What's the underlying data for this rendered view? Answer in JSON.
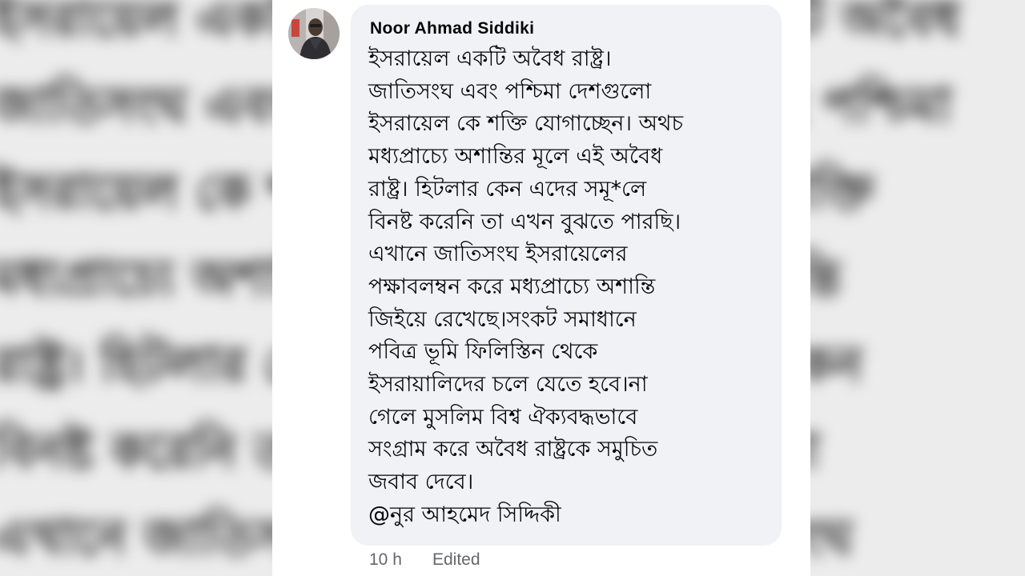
{
  "comment": {
    "author": "Noor Ahmad Siddiki",
    "lines": [
      "ইসরায়েল একটি অবৈধ রাষ্ট্র।",
      "জাতিসংঘ এবং পশ্চিমা দেশগুলো",
      "ইসরায়েল কে শক্তি যোগাচ্ছেন। অথচ",
      "মধ্যপ্রাচ্যে অশান্তির মূলে এই অবৈধ",
      "রাষ্ট্র। হিটলার কেন এদের সমূ*লে",
      "বিনষ্ট করেনি তা এখন বুঝতে পারছি।",
      "এখানে জাতিসংঘ ইসরায়েলের",
      "পক্ষাবলম্বন করে মধ্যপ্রাচ্যে অশান্তি",
      "জিইয়ে রেখেছে।সংকট সমাধানে",
      "পবিত্র ভূমি ফিলিস্তিন থেকে",
      "ইসরায়ালিদের চলে যেতে হবে।না",
      "গেলে মুসলিম বিশ্ব ঐক্যবদ্ধভাবে",
      "সংগ্রাম করে অবৈধ রাষ্ট্রকে সমুচিত",
      "জবাব দেবে।",
      "@নুর আহমেদ সিদ্দিকী"
    ],
    "time": "10 h",
    "edited_label": "Edited"
  },
  "colors": {
    "bubble": "#f0f2f5",
    "text": "#050505",
    "meta": "#65676b"
  },
  "icons": {
    "avatar": "profile-photo"
  }
}
